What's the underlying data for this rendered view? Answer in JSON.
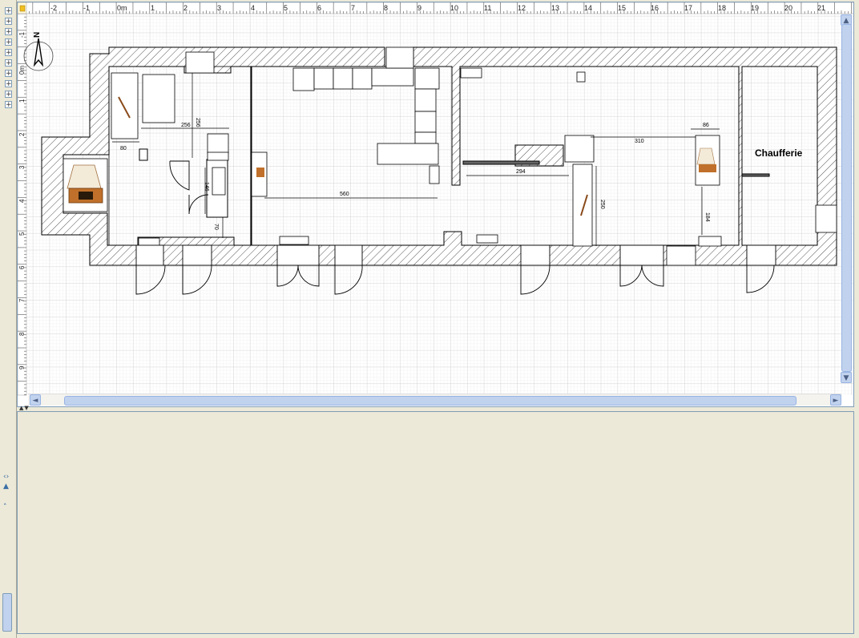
{
  "ruler": {
    "x_labels": [
      "-2",
      "-1",
      "0m",
      "1",
      "2",
      "3",
      "4",
      "5",
      "6",
      "7",
      "8",
      "9",
      "10",
      "11",
      "12",
      "13",
      "14",
      "15",
      "16",
      "17",
      "18",
      "19",
      "20",
      "21"
    ],
    "y_labels": [
      "-1",
      "0m",
      "1",
      "2",
      "3",
      "4",
      "5",
      "6",
      "7",
      "8",
      "9"
    ]
  },
  "compass": {
    "north_label": "N"
  },
  "rooms": [
    {
      "name": "Chaufferie"
    }
  ],
  "dimensions": [
    "256",
    "256",
    "80",
    "146",
    "70",
    "560",
    "294",
    "310",
    "250",
    "86",
    "184"
  ],
  "icons": {
    "tree_expanders": "plus-box",
    "fireplace": "fireplace-icon",
    "staircase": "staircase-icon",
    "appliance": "appliance-icon",
    "door": "door-icon"
  },
  "colors": {
    "wall_outline": "#000000",
    "wall_hatch": "#555555",
    "grid_fine": "#E8E8E8",
    "grid_major": "#C8C8C8",
    "scroll_thumb": "#C1D2EE",
    "panel_bg": "#ECE9D8"
  }
}
